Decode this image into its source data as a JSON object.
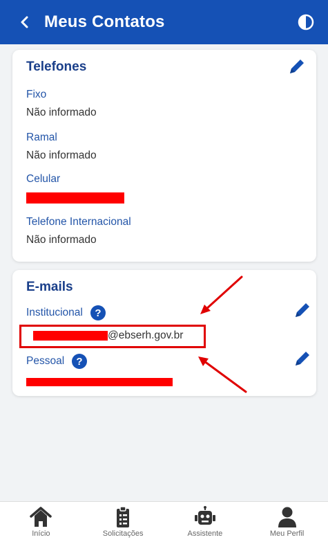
{
  "header": {
    "title": "Meus Contatos",
    "accent": "#1551b5"
  },
  "phones": {
    "title": "Telefones",
    "fixo_label": "Fixo",
    "fixo_value": "Não informado",
    "ramal_label": "Ramal",
    "ramal_value": "Não informado",
    "celular_label": "Celular",
    "internacional_label": "Telefone Internacional",
    "internacional_value": "Não informado"
  },
  "emails": {
    "title": "E-mails",
    "institucional_label": "Institucional",
    "institucional_value_suffix": "@ebserh.gov.br",
    "pessoal_label": "Pessoal"
  },
  "nav": {
    "items": [
      {
        "label": "Início",
        "icon": "home-icon"
      },
      {
        "label": "Solicitações",
        "icon": "clipboard-icon"
      },
      {
        "label": "Assistente",
        "icon": "robot-icon"
      },
      {
        "label": "Meu Perfil",
        "icon": "user-icon"
      }
    ]
  },
  "colors": {
    "redaction": "#ff0000",
    "label_blue": "#2355a8",
    "title_blue": "#1a3f8a"
  }
}
